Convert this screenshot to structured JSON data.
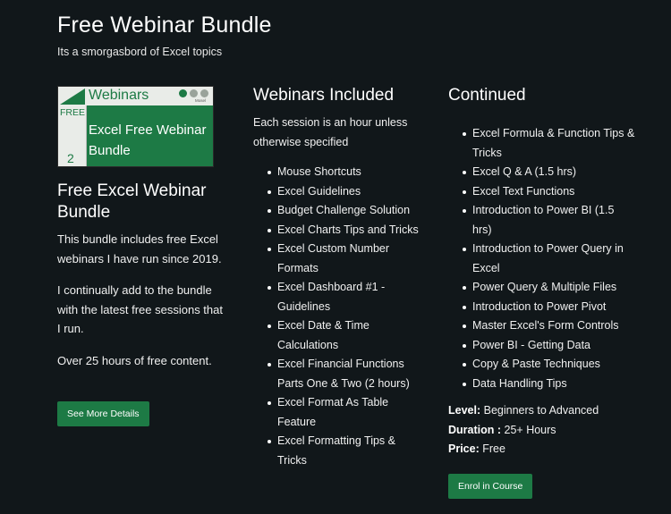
{
  "header": {
    "title": "Free Webinar Bundle",
    "subtitle": "Its a smorgasbord of Excel topics"
  },
  "thumbnail": {
    "label": "Webinars",
    "free_tag": "FREE",
    "number": "2",
    "brand": "Mosel",
    "text_line1": "Excel Free Webinar",
    "text_line2": "Bundle"
  },
  "course": {
    "title": "Free Excel Webinar Bundle",
    "paragraphs": [
      "This bundle includes free Excel webinars I have run since 2019.",
      "I continually add to the bundle with the latest free sessions that I run.",
      "Over 25 hours of free content."
    ],
    "details_button": "See More Details"
  },
  "included": {
    "heading": "Webinars Included",
    "intro": "Each session is an hour unless otherwise specified",
    "items": [
      "Mouse Shortcuts",
      "Excel Guidelines",
      "Budget Challenge Solution",
      "Excel Charts Tips and Tricks",
      "Excel Custom Number Formats",
      "Excel Dashboard #1 - Guidelines",
      "Excel Date & Time Calculations",
      "Excel Financial Functions Parts One & Two (2 hours)",
      "Excel Format As Table Feature",
      "Excel Formatting Tips & Tricks"
    ]
  },
  "continued": {
    "heading": "Continued",
    "items": [
      "Excel Formula & Function Tips & Tricks",
      "Excel Q & A  (1.5 hrs)",
      "Excel Text Functions",
      "Introduction to Power BI (1.5 hrs)",
      "Introduction to Power Query in Excel",
      "Power Query & Multiple Files",
      "Introduction to Power Pivot",
      "Master Excel's Form Controls",
      "Power BI - Getting Data",
      "Copy & Paste Techniques",
      "Data Handling Tips"
    ],
    "level_label": "Level:",
    "level_value": "Beginners to Advanced",
    "duration_label": "Duration :",
    "duration_value": "25+ Hours",
    "price_label": "Price:",
    "price_value": "Free",
    "enrol_button": "Enrol in Course"
  },
  "colors": {
    "background": "#11171a",
    "accent_green": "#1d7a45"
  }
}
